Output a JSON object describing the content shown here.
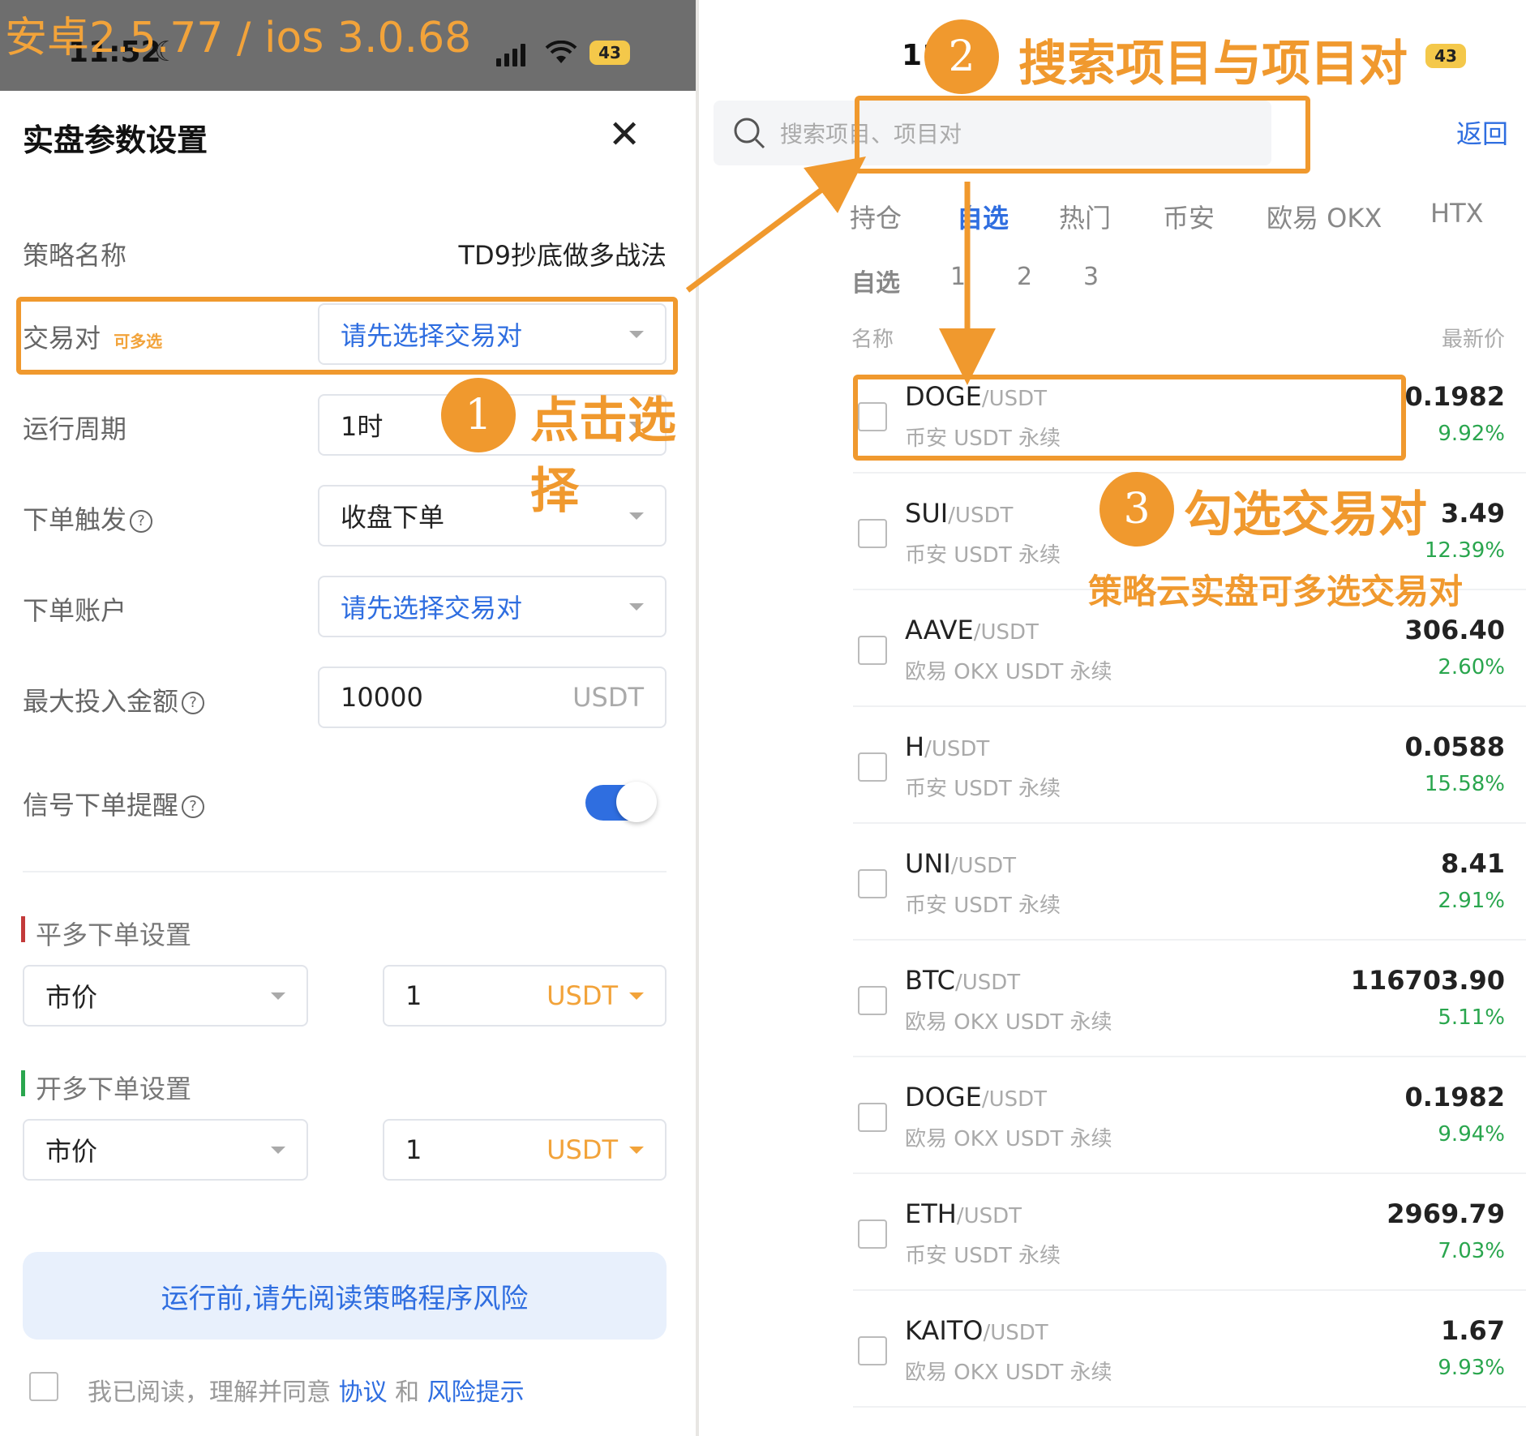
{
  "version_overlay": "安卓2.5.77 / ios 3.0.68",
  "status": {
    "time_left": "11:52",
    "battery": "43",
    "time_right": "11",
    "battery_right": "43"
  },
  "sheet": {
    "title": "实盘参数设置",
    "close_symbol": "✕",
    "strategy_label": "策略名称",
    "strategy_value": "TD9抄底做多战法",
    "pair_label": "交易对",
    "pair_multi": "可多选",
    "pair_placeholder": "请先选择交易对",
    "period_label": "运行周期",
    "period_value": "1时",
    "trigger_label": "下单触发",
    "trigger_value": "收盘下单",
    "account_label": "下单账户",
    "account_placeholder": "请先选择交易对",
    "max_label": "最大投入金额",
    "max_value": "10000",
    "max_unit": "USDT",
    "remind_label": "信号下单提醒",
    "remind_on": true,
    "close_long_title": "平多下单设置",
    "close_long_type": "市价",
    "close_long_amount": "1",
    "close_long_unit": "USDT",
    "open_long_title": "开多下单设置",
    "open_long_type": "市价",
    "open_long_amount": "1",
    "open_long_unit": "USDT",
    "risk_button": "运行前,请先阅读策略程序风险",
    "agree_text": "我已阅读，理解并同意",
    "agree_link1": "协议",
    "agree_and": "和",
    "agree_link2": "风险提示",
    "help_symbol": "?"
  },
  "annotations": {
    "step1_num": "1",
    "step1_text": "点击选择",
    "step2_num": "2",
    "step2_text": "搜索项目与项目对",
    "step3_num": "3",
    "step3_text": "勾选交易对",
    "step3_sub": "策略云实盘可多选交易对",
    "accent": "#f0992e"
  },
  "market": {
    "search_placeholder": "搜索项目、项目对",
    "back": "返回",
    "tabs": [
      "持仓",
      "自选",
      "热门",
      "币安",
      "欧易 OKX",
      "HTX"
    ],
    "active_tab": "自选",
    "subtabs": [
      "自选",
      "1",
      "2",
      "3"
    ],
    "col_name": "名称",
    "col_price": "最新价",
    "rows": [
      {
        "sym": "DOGE",
        "quote": "/USDT",
        "ex": "币安 USDT 永续",
        "price": "0.1982",
        "chg": "9.92%"
      },
      {
        "sym": "SUI",
        "quote": "/USDT",
        "ex": "币安 USDT 永续",
        "price": "3.49",
        "chg": "12.39%"
      },
      {
        "sym": "AAVE",
        "quote": "/USDT",
        "ex": "欧易 OKX USDT 永续",
        "price": "306.40",
        "chg": "2.60%"
      },
      {
        "sym": "H",
        "quote": "/USDT",
        "ex": "币安 USDT 永续",
        "price": "0.0588",
        "chg": "15.58%"
      },
      {
        "sym": "UNI",
        "quote": "/USDT",
        "ex": "币安 USDT 永续",
        "price": "8.41",
        "chg": "2.91%"
      },
      {
        "sym": "BTC",
        "quote": "/USDT",
        "ex": "欧易 OKX USDT 永续",
        "price": "116703.90",
        "chg": "5.11%"
      },
      {
        "sym": "DOGE",
        "quote": "/USDT",
        "ex": "欧易 OKX USDT 永续",
        "price": "0.1982",
        "chg": "9.94%"
      },
      {
        "sym": "ETH",
        "quote": "/USDT",
        "ex": "币安 USDT 永续",
        "price": "2969.79",
        "chg": "7.03%"
      },
      {
        "sym": "KAITO",
        "quote": "/USDT",
        "ex": "欧易 OKX USDT 永续",
        "price": "1.67",
        "chg": "9.93%"
      }
    ]
  }
}
